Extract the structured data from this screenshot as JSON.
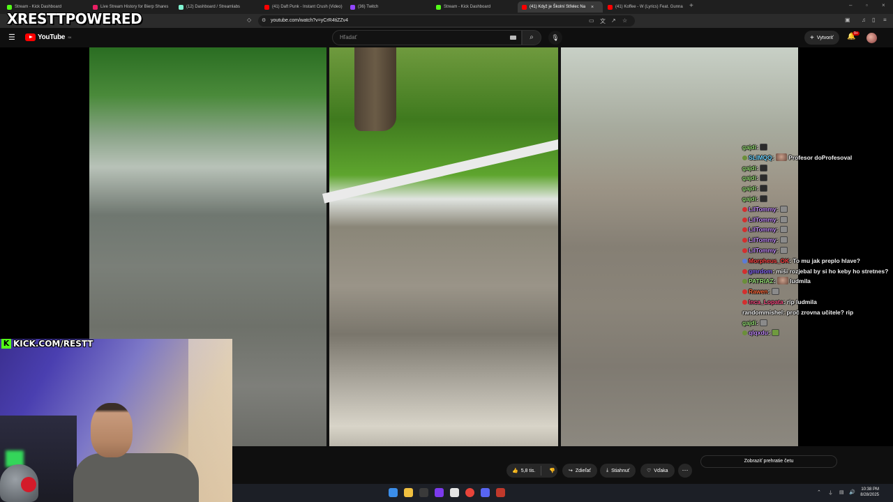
{
  "browser": {
    "tabs": [
      {
        "label": "Stream - Kick Dashboard",
        "color": "#53fc18"
      },
      {
        "label": "Live Stream History for Bierp Shares",
        "color": "#e91e63"
      },
      {
        "label": "(12) Dashboard / Streamlabs",
        "color": "#80f5d2"
      },
      {
        "label": "(41) Daft Punk - Instant Crush (Video)",
        "color": "#ff0000"
      },
      {
        "label": "(36) Twitch",
        "color": "#9146ff"
      },
      {
        "label": "Stream - Kick Dashboard",
        "color": "#53fc18"
      },
      {
        "label": "(41) Když je Školní Střelec Na",
        "color": "#ff0000",
        "active": true
      },
      {
        "label": "(41) Koffee - W (Lyrics) Feat. Gunna",
        "color": "#ff0000"
      }
    ],
    "url": "youtube.com/watch?v=yCrR4tiZZv4"
  },
  "overlay": {
    "brand": "XRESTTPOWERED",
    "kick_banner": "KICK.COM/RESTT"
  },
  "youtube": {
    "logo": "YouTube",
    "region": "SK",
    "search_placeholder": "Hľadať",
    "create_label": "Vytvoriť",
    "notif_count": "9+"
  },
  "chat": [
    {
      "user": "gajdi",
      "color": "#9be37a",
      "text": "",
      "emote": "dark",
      "badge": ""
    },
    {
      "user": "SLIMQQ",
      "color": "#6fd5ff",
      "text": "Profesor doProfesoval",
      "emote": "face",
      "badge": "#6b8f3a"
    },
    {
      "user": "gajdi",
      "color": "#9be37a",
      "text": "",
      "emote": "dark",
      "badge": ""
    },
    {
      "user": "gajdi",
      "color": "#9be37a",
      "text": "",
      "emote": "dark",
      "badge": ""
    },
    {
      "user": "gajdi",
      "color": "#9be37a",
      "text": "",
      "emote": "dark",
      "badge": ""
    },
    {
      "user": "gajdi",
      "color": "#9be37a",
      "text": "",
      "emote": "dark",
      "badge": ""
    },
    {
      "user": "LilTommy",
      "color": "#c58cff",
      "text": "",
      "emote": "cat",
      "badge": "#d32f2f"
    },
    {
      "user": "LilTommy",
      "color": "#c58cff",
      "text": "",
      "emote": "cat",
      "badge": "#d32f2f"
    },
    {
      "user": "LilTommy",
      "color": "#c58cff",
      "text": "",
      "emote": "cat",
      "badge": "#d32f2f"
    },
    {
      "user": "LilTommy",
      "color": "#c58cff",
      "text": "",
      "emote": "cat",
      "badge": "#d32f2f"
    },
    {
      "user": "LilTommy",
      "color": "#c58cff",
      "text": "",
      "emote": "cat",
      "badge": "#d32f2f"
    },
    {
      "user": "Morpheus_OK",
      "color": "#ff4444",
      "text": "To mu jak preplo hlave?",
      "emote": "",
      "badge": "#5b7bd6"
    },
    {
      "user": "gmrdom",
      "color": "#8c6cff",
      "text": "miši rozjebal by si ho keby ho stretnes?",
      "emote": "",
      "badge": "#d32f2f"
    },
    {
      "user": "PATRIAZ",
      "color": "#9be37a",
      "text": "ludmila",
      "emote": "face",
      "badge": "#6b8f3a"
    },
    {
      "user": "Rawen",
      "color": "#ff6b3d",
      "text": "",
      "emote": "cat",
      "badge": "#d32f2f"
    },
    {
      "user": "Inca_Lopata",
      "color": "#ff4f86",
      "text": "rip ludmila",
      "emote": "",
      "badge": "#d32f2f"
    },
    {
      "user": "randommishel",
      "color": "#f1f1f1",
      "text": "proč zrovna učitele? rip",
      "emote": "",
      "badge": ""
    },
    {
      "user": "gajdi",
      "color": "#9be37a",
      "text": "",
      "emote": "cat",
      "badge": ""
    },
    {
      "user": "qlqxdu",
      "color": "#c58cff",
      "text": "",
      "emote": "frog",
      "badge": "#6b8f3a"
    }
  ],
  "actions": {
    "likes": "5,8 tis.",
    "share": "Zdieľať",
    "download": "Stiahnuť",
    "thanks": "Vďaka",
    "chat_replay": "Zobraziť prehratie četu"
  },
  "taskbar": {
    "time": "10:38 PM",
    "date": "8/28/2025"
  }
}
